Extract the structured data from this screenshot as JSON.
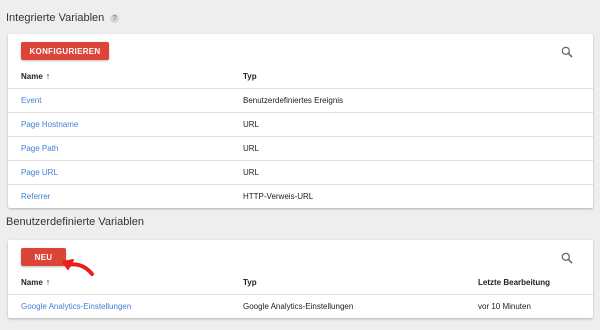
{
  "builtin": {
    "title": "Integrierte Variablen",
    "help_icon": "?",
    "configure_label": "KONFIGURIEREN",
    "columns": {
      "name": "Name",
      "type": "Typ"
    },
    "sort_arrow": "↑",
    "rows": [
      {
        "name": "Event",
        "type": "Benutzerdefiniertes Ereignis"
      },
      {
        "name": "Page Hostname",
        "type": "URL"
      },
      {
        "name": "Page Path",
        "type": "URL"
      },
      {
        "name": "Page URL",
        "type": "URL"
      },
      {
        "name": "Referrer",
        "type": "HTTP-Verweis-URL"
      }
    ]
  },
  "custom": {
    "title": "Benutzerdefinierte Variablen",
    "new_label": "NEU",
    "columns": {
      "name": "Name",
      "type": "Typ",
      "last_edit": "Letzte Bearbeitung"
    },
    "sort_arrow": "↑",
    "rows": [
      {
        "name": "Google Analytics-Einstellungen",
        "type": "Google Analytics-Einstellungen",
        "last_edit": "vor 10 Minuten"
      }
    ]
  },
  "colors": {
    "accent": "#db4437",
    "link": "#3f7fd7",
    "annotation": "#e8201c"
  },
  "icons": {
    "search": "search-icon",
    "help": "help-icon"
  }
}
